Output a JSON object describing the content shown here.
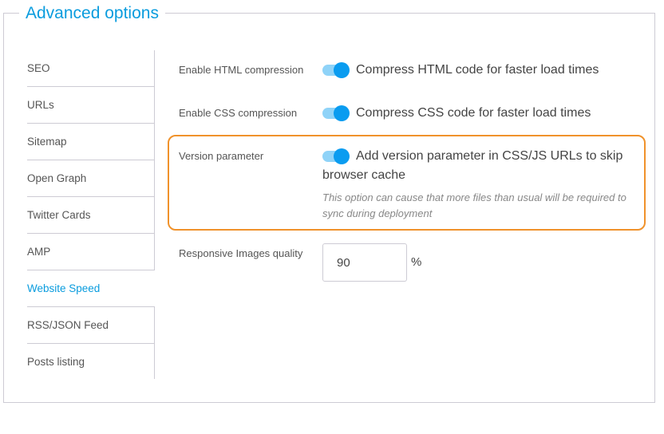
{
  "panel": {
    "title": "Advanced options"
  },
  "sidebar": {
    "items": [
      {
        "label": "SEO",
        "active": false
      },
      {
        "label": "URLs",
        "active": false
      },
      {
        "label": "Sitemap",
        "active": false
      },
      {
        "label": "Open Graph",
        "active": false
      },
      {
        "label": "Twitter Cards",
        "active": false
      },
      {
        "label": "AMP",
        "active": false
      },
      {
        "label": "Website Speed",
        "active": true
      },
      {
        "label": "RSS/JSON Feed",
        "active": false
      },
      {
        "label": "Posts listing",
        "active": false
      }
    ]
  },
  "settings": {
    "html_compression": {
      "label": "Enable HTML compression",
      "enabled": true,
      "description": "Compress HTML code for faster load times"
    },
    "css_compression": {
      "label": "Enable CSS compression",
      "enabled": true,
      "description": "Compress CSS code for faster load times"
    },
    "version_parameter": {
      "label": "Version parameter",
      "enabled": true,
      "description": "Add version parameter in CSS/JS URLs to skip browser cache",
      "note": "This option can cause that more files than usual will be required to sync during deployment"
    },
    "responsive_images_quality": {
      "label": "Responsive Images quality",
      "value": "90",
      "unit": "%"
    }
  },
  "colors": {
    "accent": "#0a9cde",
    "toggle_knob": "#0a9cf0",
    "toggle_track": "#8fd3f8",
    "highlight_border": "#f0922b",
    "border": "#cdcbd4"
  }
}
